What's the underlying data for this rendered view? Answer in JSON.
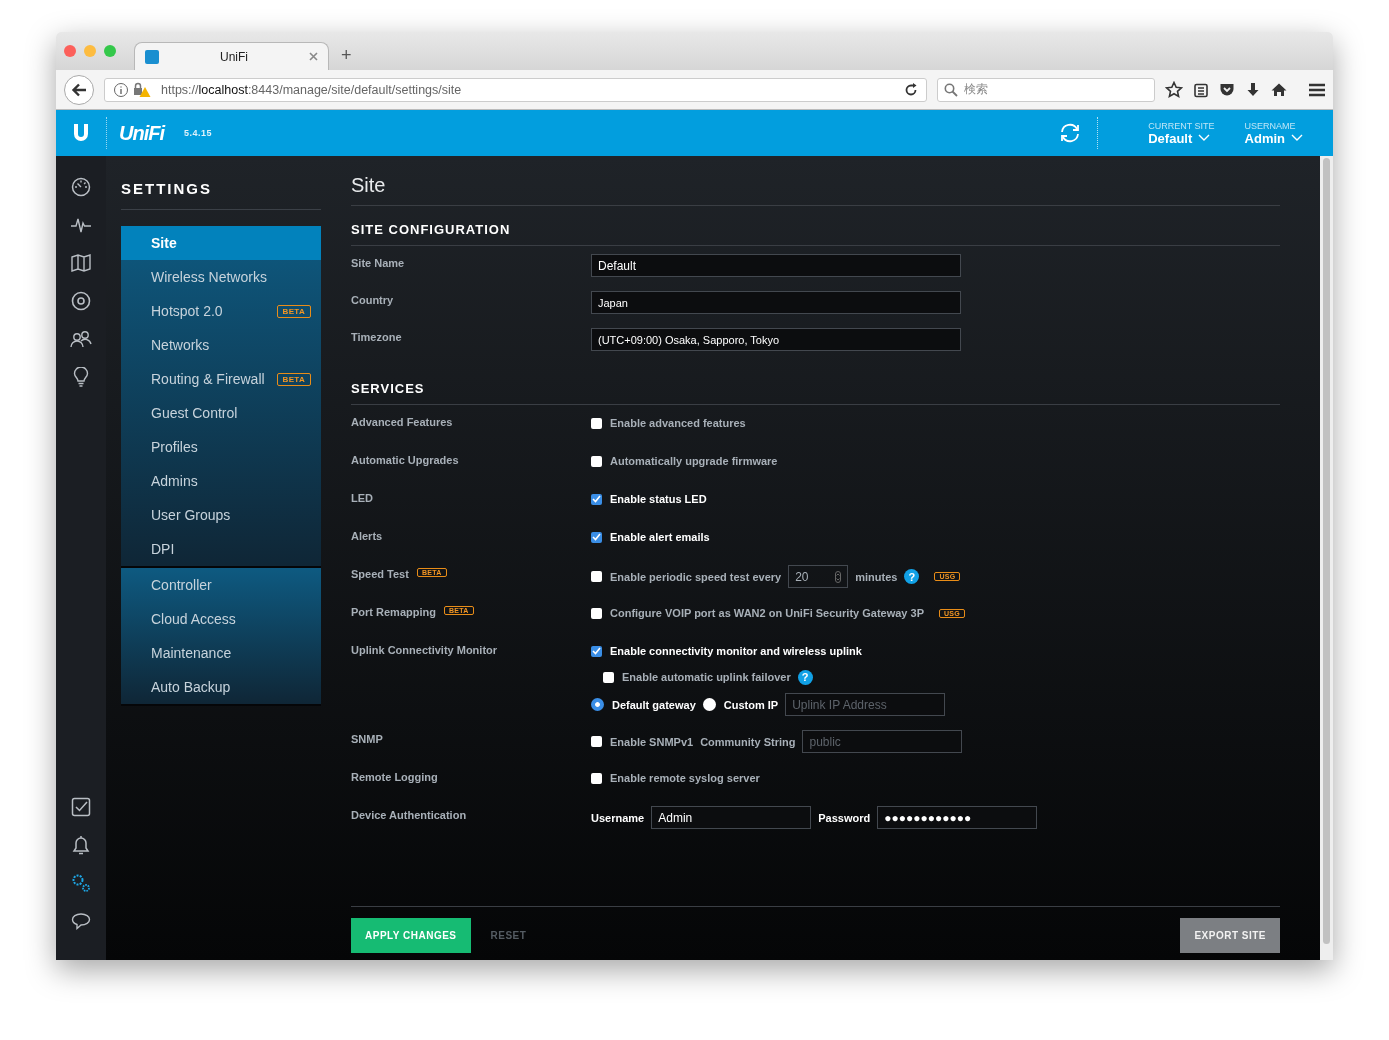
{
  "browser": {
    "tab_title": "UniFi",
    "new_tab": "+",
    "url_prefix": "https://",
    "url_host": "localhost",
    "url_path": ":8443/manage/site/default/settings/site",
    "search_placeholder": "検索"
  },
  "header": {
    "logo": "UniFi",
    "version": "5.4.15",
    "current_site_label": "CURRENT SITE",
    "current_site": "Default",
    "username_label": "USERNAME",
    "username": "Admin"
  },
  "rail": {
    "top": [
      {
        "kind": "dashboard",
        "selected": false
      },
      {
        "kind": "statistics",
        "selected": false
      },
      {
        "kind": "map",
        "selected": false
      },
      {
        "kind": "devices",
        "selected": false
      },
      {
        "kind": "clients",
        "selected": false
      },
      {
        "kind": "insights",
        "selected": false
      }
    ],
    "bottom": [
      {
        "kind": "tasks",
        "selected": false
      },
      {
        "kind": "alerts",
        "selected": false
      },
      {
        "kind": "settings",
        "selected": true
      },
      {
        "kind": "chat",
        "selected": false
      }
    ]
  },
  "settings_menu": {
    "title": "SETTINGS",
    "groups": [
      [
        {
          "label": "Site",
          "selected": true
        },
        {
          "label": "Wireless Networks",
          "selected": false
        },
        {
          "label": "Hotspot 2.0",
          "selected": false,
          "badge": "BETA"
        },
        {
          "label": "Networks",
          "selected": false
        },
        {
          "label": "Routing & Firewall",
          "selected": false,
          "badge": "BETA"
        },
        {
          "label": "Guest Control",
          "selected": false
        },
        {
          "label": "Profiles",
          "selected": false
        },
        {
          "label": "Admins",
          "selected": false
        },
        {
          "label": "User Groups",
          "selected": false
        },
        {
          "label": "DPI",
          "selected": false
        }
      ],
      [
        {
          "label": "Controller",
          "selected": false
        },
        {
          "label": "Cloud Access",
          "selected": false
        },
        {
          "label": "Maintenance",
          "selected": false
        },
        {
          "label": "Auto Backup",
          "selected": false
        }
      ]
    ]
  },
  "page_title": "Site",
  "sections": [
    {
      "title": "SITE CONFIGURATION",
      "rows": [
        {
          "label": "Site Name",
          "lines": [
            [
              {
                "kind": "input",
                "value": "Default"
              }
            ]
          ]
        },
        {
          "label": "Country",
          "lines": [
            [
              {
                "kind": "select",
                "value": "Japan"
              }
            ]
          ]
        },
        {
          "label": "Timezone",
          "lines": [
            [
              {
                "kind": "select",
                "value": "(UTC+09:00) Osaka, Sapporo, Tokyo"
              }
            ]
          ]
        }
      ]
    },
    {
      "title": "SERVICES",
      "rows": [
        {
          "label": "Advanced Features",
          "lines": [
            [
              {
                "kind": "checkbox",
                "label": "Enable advanced features",
                "checked": false
              }
            ]
          ]
        },
        {
          "label": "Automatic Upgrades",
          "lines": [
            [
              {
                "kind": "checkbox",
                "label": "Automatically upgrade firmware",
                "checked": false
              }
            ]
          ]
        },
        {
          "label": "LED",
          "lines": [
            [
              {
                "kind": "checkbox",
                "label": "Enable status LED",
                "checked": true
              }
            ]
          ]
        },
        {
          "label": "Alerts",
          "lines": [
            [
              {
                "kind": "checkbox",
                "label": "Enable alert emails",
                "checked": true
              }
            ]
          ]
        },
        {
          "label": "Speed Test",
          "badge": "BETA",
          "lines": [
            [
              {
                "kind": "checkbox",
                "label": "Enable periodic speed test every",
                "checked": false
              },
              {
                "kind": "number",
                "value": "20"
              },
              {
                "kind": "text",
                "text": "minutes"
              },
              {
                "kind": "help",
                "text": "?"
              },
              {
                "kind": "tag",
                "text": "USG"
              }
            ]
          ]
        },
        {
          "label": "Port Remapping",
          "badge": "BETA",
          "lines": [
            [
              {
                "kind": "checkbox",
                "label": "Configure VOIP port as WAN2 on UniFi Security Gateway 3P",
                "checked": false
              },
              {
                "kind": "tag",
                "text": "USG"
              }
            ]
          ]
        },
        {
          "label": "Uplink Connectivity Monitor",
          "lines": [
            [
              {
                "kind": "checkbox",
                "label": "Enable connectivity monitor and wireless uplink",
                "checked": true
              }
            ],
            [
              {
                "kind": "indent"
              },
              {
                "kind": "checkbox",
                "label": "Enable automatic uplink failover",
                "checked": false
              },
              {
                "kind": "help",
                "text": "?"
              }
            ],
            [
              {
                "kind": "radio",
                "label": "Default gateway",
                "selected": true
              },
              {
                "kind": "radio",
                "label": "Custom IP",
                "selected": false
              },
              {
                "kind": "input",
                "placeholder": "Uplink IP Address"
              }
            ]
          ]
        },
        {
          "label": "SNMP",
          "lines": [
            [
              {
                "kind": "checkbox",
                "label": "Enable SNMPv1",
                "checked": false
              },
              {
                "kind": "text",
                "text": "Community String"
              },
              {
                "kind": "input",
                "placeholder": "public"
              }
            ]
          ]
        },
        {
          "label": "Remote Logging",
          "lines": [
            [
              {
                "kind": "checkbox",
                "label": "Enable remote syslog server",
                "checked": false
              }
            ]
          ]
        },
        {
          "label": "Device Authentication",
          "lines": [
            [
              {
                "kind": "caption",
                "text": "Username"
              },
              {
                "kind": "input",
                "value": "Admin"
              },
              {
                "kind": "caption",
                "text": "Password"
              },
              {
                "kind": "input",
                "value": "●●●●●●●●●●●●"
              }
            ]
          ]
        }
      ]
    }
  ],
  "footer": {
    "apply": "APPLY CHANGES",
    "reset": "RESET",
    "export": "EXPORT SITE"
  }
}
